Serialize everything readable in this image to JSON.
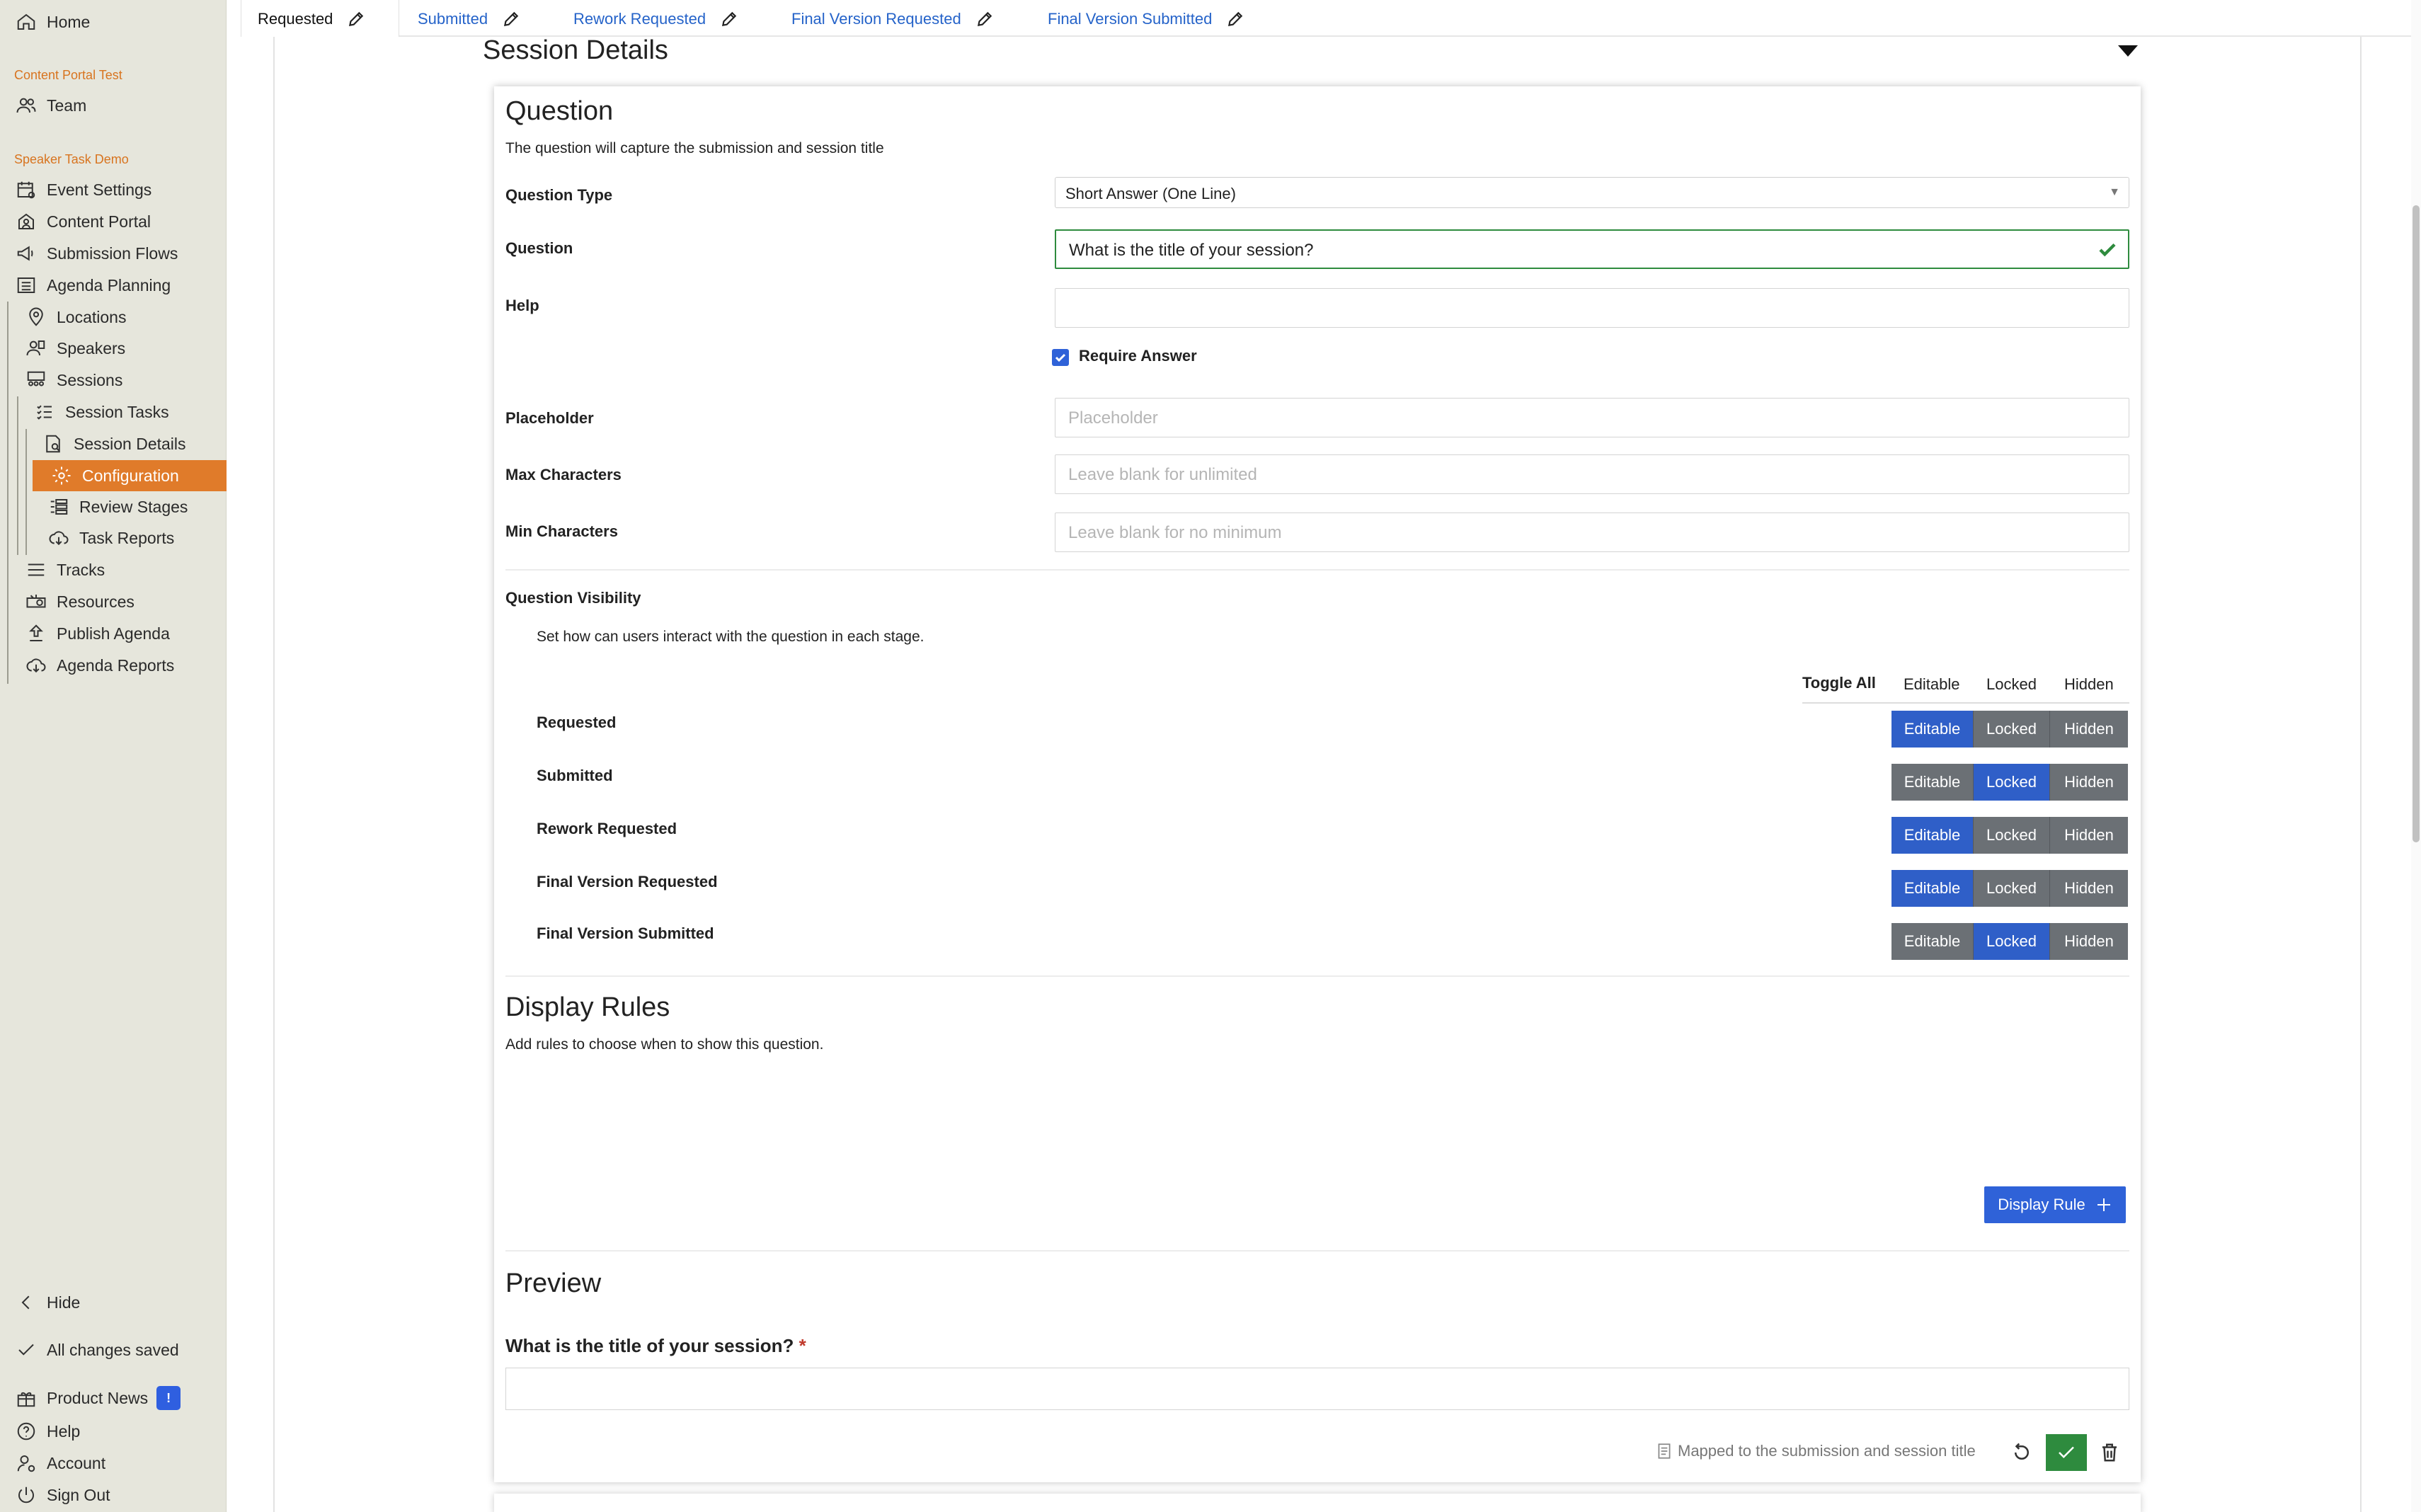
{
  "sidebar": {
    "home": "Home",
    "group1": "Content Portal Test",
    "team": "Team",
    "group2": "Speaker Task Demo",
    "event_settings": "Event Settings",
    "content_portal": "Content Portal",
    "submission_flows": "Submission Flows",
    "agenda_planning": "Agenda Planning",
    "locations": "Locations",
    "speakers": "Speakers",
    "sessions": "Sessions",
    "session_tasks": "Session Tasks",
    "session_details": "Session Details",
    "configuration": "Configuration",
    "review_stages": "Review Stages",
    "task_reports": "Task Reports",
    "tracks": "Tracks",
    "resources": "Resources",
    "publish_agenda": "Publish Agenda",
    "agenda_reports": "Agenda Reports",
    "hide": "Hide",
    "saved": "All changes saved",
    "product_news": "Product News",
    "news_badge": "!",
    "help": "Help",
    "account": "Account",
    "sign_out": "Sign Out"
  },
  "tabs": [
    "Requested",
    "Submitted",
    "Rework Requested",
    "Final Version Requested",
    "Final Version Submitted"
  ],
  "section_title": "Session Details",
  "question": {
    "heading": "Question",
    "subtitle": "The question will capture the submission and session title",
    "type_label": "Question Type",
    "type_value": "Short Answer (One Line)",
    "question_label": "Question",
    "question_value": "What is the title of your session?",
    "help_label": "Help",
    "require_label": "Require Answer",
    "placeholder_label": "Placeholder",
    "placeholder_ph": "Placeholder",
    "max_label": "Max Characters",
    "max_ph": "Leave blank for unlimited",
    "min_label": "Min Characters",
    "min_ph": "Leave blank for no minimum"
  },
  "visibility": {
    "heading": "Question Visibility",
    "subtitle": "Set how can users interact with the question in each stage.",
    "toggle_all": "Toggle All",
    "editable": "Editable",
    "locked": "Locked",
    "hidden": "Hidden",
    "rows": [
      {
        "stage": "Requested",
        "selected": "Editable"
      },
      {
        "stage": "Submitted",
        "selected": "Locked"
      },
      {
        "stage": "Rework Requested",
        "selected": "Editable"
      },
      {
        "stage": "Final Version Requested",
        "selected": "Editable"
      },
      {
        "stage": "Final Version Submitted",
        "selected": "Locked"
      }
    ]
  },
  "display_rules": {
    "heading": "Display Rules",
    "subtitle": "Add rules to choose when to show this question.",
    "button": "Display Rule"
  },
  "preview": {
    "heading": "Preview",
    "question": "What is the title of your session?",
    "required_mark": "*",
    "mapped_note": "Mapped to the submission and session title"
  },
  "colors": {
    "accent_orange": "#e07b2a",
    "primary_blue": "#2f62d8",
    "success_green": "#2e8b3e"
  }
}
